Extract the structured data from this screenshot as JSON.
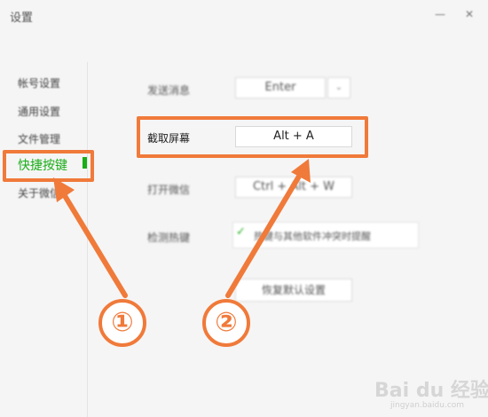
{
  "window": {
    "title": "设置",
    "minimize_glyph": "—",
    "close_glyph": "✕"
  },
  "sidebar": {
    "items": [
      {
        "label": "帐号设置"
      },
      {
        "label": "通用设置"
      },
      {
        "label": "文件管理"
      },
      {
        "label": "快捷按键"
      },
      {
        "label": "关于微信"
      }
    ],
    "active_index": 3
  },
  "shortcuts": {
    "send": {
      "label": "发送消息",
      "value": "Enter",
      "dropdown_glyph": "⌄"
    },
    "screenshot": {
      "label": "截取屏幕",
      "value": "Alt + A"
    },
    "open": {
      "label": "打开微信",
      "value": "Ctrl + Alt + W"
    },
    "detect": {
      "label": "检测热键",
      "check_glyph": "✓",
      "option_text": "热键与其他软件冲突时提醒"
    },
    "restore_label": "恢复默认设置"
  },
  "annotations": {
    "badge1": "①",
    "badge2": "②",
    "color": "#f07a3a"
  },
  "watermark": {
    "main": "Bai du 经验",
    "sub": "jingyan.baidu.com"
  },
  "colors": {
    "accent": "#1aad19",
    "annotation": "#f07a3a",
    "background": "#f5f5f5"
  }
}
